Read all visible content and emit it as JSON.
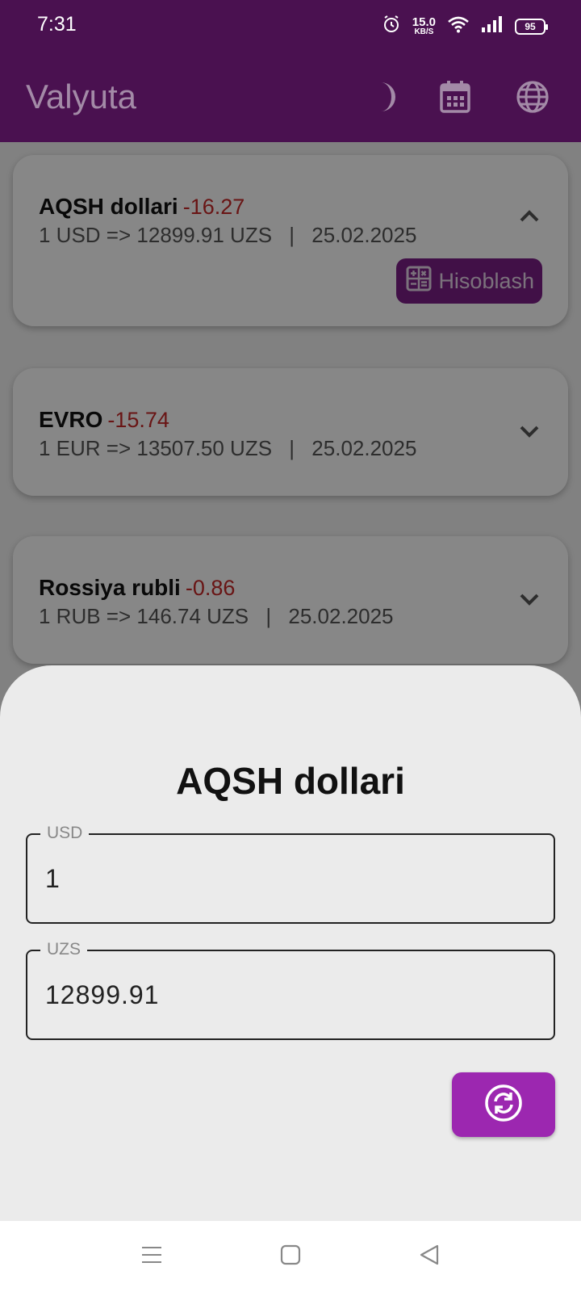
{
  "status_bar": {
    "time": "7:31",
    "speed_value": "15.0",
    "speed_unit": "KB/S",
    "battery": "95",
    "icons": [
      "alarm-icon",
      "wifi-icon",
      "signal-icon",
      "battery-icon"
    ]
  },
  "app_bar": {
    "title": "Valyuta",
    "actions": [
      "moon-icon",
      "calendar-icon",
      "globe-icon"
    ]
  },
  "currencies": [
    {
      "name": "AQSH dollari",
      "change": "-16.27",
      "rate": "1 USD => 12899.91 UZS",
      "separator": "|",
      "date": "25.02.2025",
      "expanded": true,
      "calc_label": "Hisoblash"
    },
    {
      "name": "EVRO",
      "change": "-15.74",
      "rate": "1 EUR => 13507.50 UZS",
      "separator": "|",
      "date": "25.02.2025",
      "expanded": false
    },
    {
      "name": "Rossiya rubli",
      "change": "-0.86",
      "rate": "1 RUB => 146.74 UZS",
      "separator": "|",
      "date": "25.02.2025",
      "expanded": false
    }
  ],
  "sheet": {
    "title": "AQSH dollari",
    "from": {
      "label": "USD",
      "value": "1"
    },
    "to": {
      "label": "UZS",
      "value": "12899.91"
    },
    "swap_icon": "swap-icon"
  },
  "nav_bar": {
    "icons": [
      "menu-icon",
      "home-icon",
      "back-icon"
    ]
  },
  "colors": {
    "primary_dark": "#4a1150",
    "accent": "#9c27b0",
    "negative": "#c62828",
    "sheet_bg": "#ebebeb"
  }
}
